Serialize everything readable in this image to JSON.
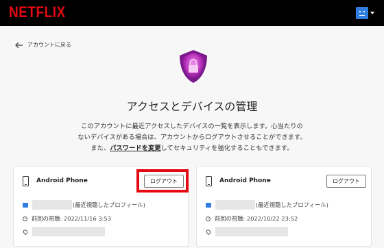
{
  "header": {
    "logo": "NETFLIX",
    "avatar_icon": "profile-avatar-icon",
    "colors": {
      "brand": "#e50914",
      "avatar": "#2f7de1",
      "bar": "#000000"
    }
  },
  "nav": {
    "back_label": "アカウントに戻る"
  },
  "page": {
    "title": "アクセスとデバイスの管理",
    "desc_line1": "このアカウントに最近アクセスしたデバイスの一覧を表示します。心当たりの",
    "desc_line2": "ないデバイスがある場合は、アカウントからログアウトさせることができます。",
    "desc_line3_pre": "また、",
    "desc_link": "パスワードを変更",
    "desc_line3_post": "してセキュリティを強化することもできます。"
  },
  "devices": [
    {
      "name": "Android Phone",
      "logout_label": "ログアウト",
      "profile_suffix": "(最近視聴したプロフィール)",
      "last_watched": "前回の視聴: 2022/11/16 3:53",
      "highlighted": true
    },
    {
      "name": "Android Phone",
      "logout_label": "ログアウト",
      "profile_suffix": "(最近視聴したプロフィール)",
      "last_watched": "前回の視聴: 2022/10/22 23:52",
      "highlighted": false
    }
  ]
}
